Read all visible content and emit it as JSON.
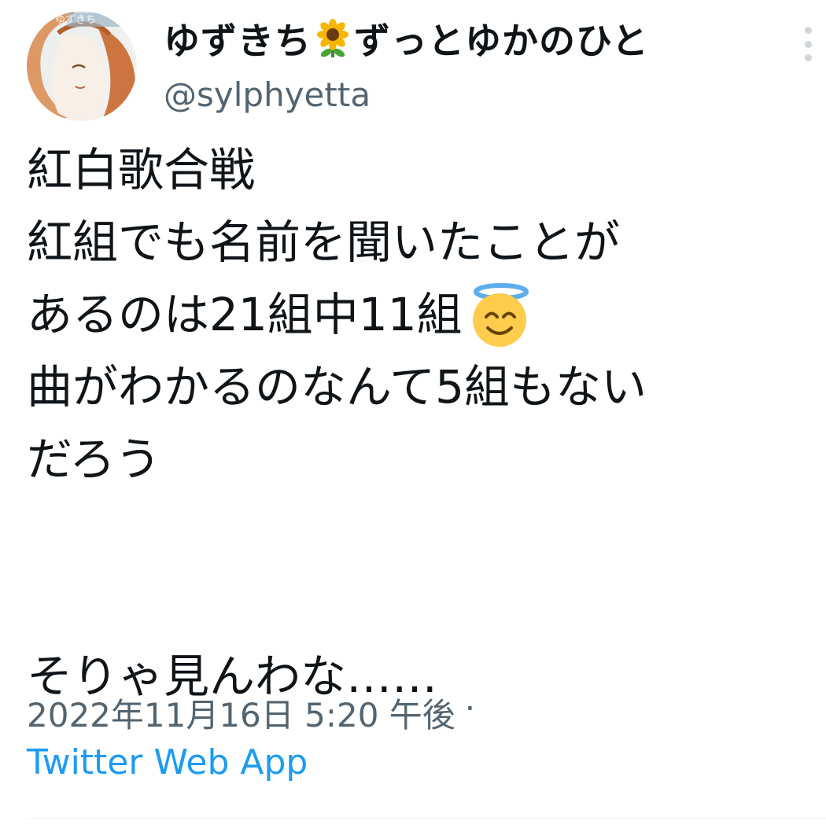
{
  "user": {
    "display_name_prefix": "ゆずきち",
    "display_name_suffix": "ずっとゆかのひと",
    "name_emoji": "sunflower-emoji",
    "handle": "@sylphyetta",
    "avatar_label": "ゆずきち"
  },
  "tweet": {
    "lines": [
      "紅白歌合戦",
      "紅組でも名前を聞いたことが",
      "あるのは21組中11組",
      "曲がわかるのなんて5組もない",
      "だろう",
      "",
      "そりゃ見んわな……"
    ],
    "inline_emoji": "smiling-face-with-halo-emoji"
  },
  "meta": {
    "timestamp": "2022年11月16日 5:20 午後",
    "separator": "·",
    "source": "Twitter Web App"
  },
  "menu": {
    "icon": "more-vertical-icon"
  },
  "colors": {
    "text": "#0f1419",
    "secondary": "#536471",
    "link": "#1d9bf0"
  }
}
